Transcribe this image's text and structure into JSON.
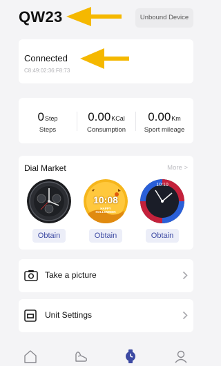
{
  "header": {
    "device_name": "QW23",
    "unbound_label": "Unbound Device"
  },
  "connection": {
    "status": "Connected",
    "mac": "C8:49:02:36:F8:73"
  },
  "stats": [
    {
      "value": "0",
      "unit": "Step",
      "label": "Steps"
    },
    {
      "value": "0.00",
      "unit": "KCal",
      "label": "Consumption"
    },
    {
      "value": "0.00",
      "unit": "Km",
      "label": "Sport mileage"
    }
  ],
  "dial_market": {
    "title": "Dial Market",
    "more_label": "More >",
    "dials": [
      {
        "name": "dark-sport-dial",
        "obtain_label": "Obtain"
      },
      {
        "name": "halloween-dial",
        "time": "10:08",
        "caption": "HAPPY HALLOWEEN",
        "obtain_label": "Obtain"
      },
      {
        "name": "red-blue-dial",
        "time": "10:10",
        "obtain_label": "Obtain"
      }
    ]
  },
  "menu": {
    "take_picture": "Take a picture",
    "unit_settings": "Unit Settings"
  },
  "tabbar": {
    "tabs": [
      "home-icon",
      "shoe-icon",
      "watch-icon",
      "profile-icon"
    ],
    "active_index": 2
  },
  "colors": {
    "accent": "#3d4aa3",
    "arrow": "#f5b800",
    "background": "#f4f4f6"
  }
}
